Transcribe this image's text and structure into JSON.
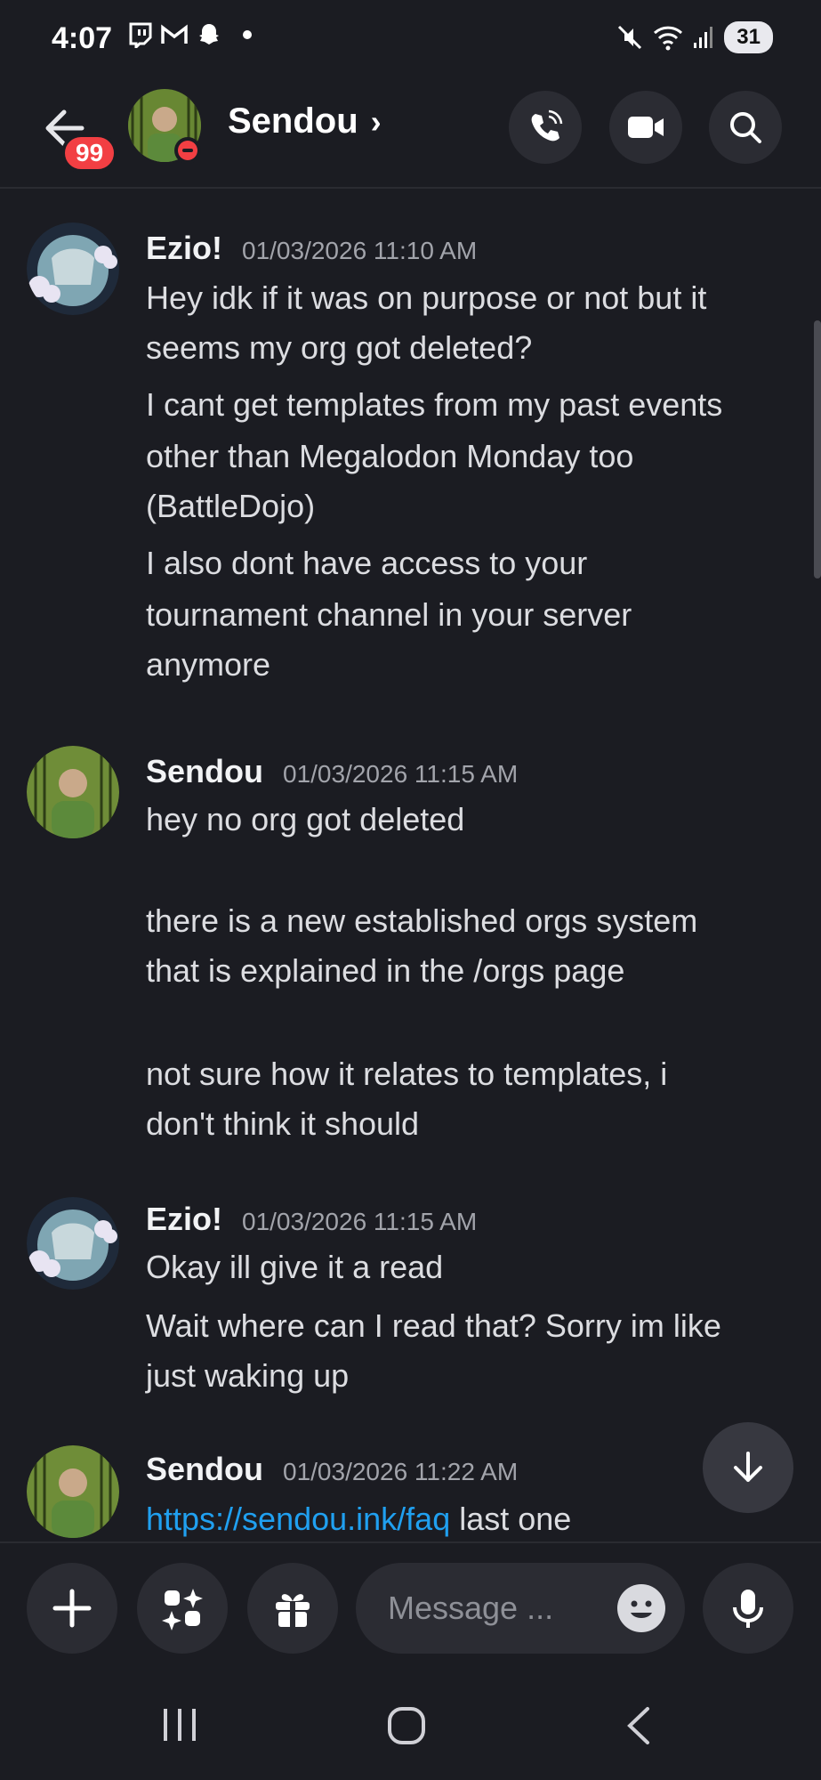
{
  "status_bar": {
    "time": "4:07",
    "battery": "31",
    "left_icons": [
      "twitch-icon",
      "gmail-icon",
      "snapchat-icon",
      "dot-icon"
    ],
    "right_icons": [
      "mute-icon",
      "wifi-icon",
      "signal-icon",
      "battery-icon"
    ]
  },
  "header": {
    "badge_count": "99",
    "title": "Sendou",
    "title_chevron": "›",
    "icons": [
      "voice-call-icon",
      "video-call-icon",
      "search-icon"
    ]
  },
  "messages": [
    {
      "author": "Ezio!",
      "timestamp": "01/03/2026 11:10 AM",
      "lines": [
        "Hey idk if it was on purpose or not but it",
        "seems my org got deleted?",
        "I cant get templates from my past events",
        "other than Megalodon Monday too",
        "(BattleDojo)",
        "I also dont have access to your",
        "tournament channel in your server",
        "anymore"
      ]
    },
    {
      "author": "Sendou",
      "timestamp": "01/03/2026 11:15 AM",
      "lines": [
        "hey no org got deleted",
        "there is a new established orgs system",
        "that is explained in the /orgs page",
        "not sure how it relates to templates, i",
        "don't think it should"
      ]
    },
    {
      "author": "Ezio!",
      "timestamp": "01/03/2026 11:15 AM",
      "lines": [
        "Okay ill give it a read",
        "Wait where can I read that? Sorry im like",
        "just waking up"
      ]
    },
    {
      "author": "Sendou",
      "timestamp": "01/03/2026 11:22 AM",
      "link": "https://sendou.ink/faq",
      "after_link": " last one"
    }
  ],
  "composer": {
    "placeholder": "Message ...",
    "icons": [
      "plus-icon",
      "apps-icon",
      "gift-icon",
      "emoji-icon",
      "microphone-icon"
    ]
  },
  "navbar": {
    "icons": [
      "recent-apps-icon",
      "home-icon",
      "back-icon"
    ]
  },
  "colors": {
    "background": "#1b1c22",
    "badge": "#f23f43",
    "link": "#20a0f0",
    "timestamp": "#a2a4ab",
    "button_bg": "#2b2c33"
  }
}
